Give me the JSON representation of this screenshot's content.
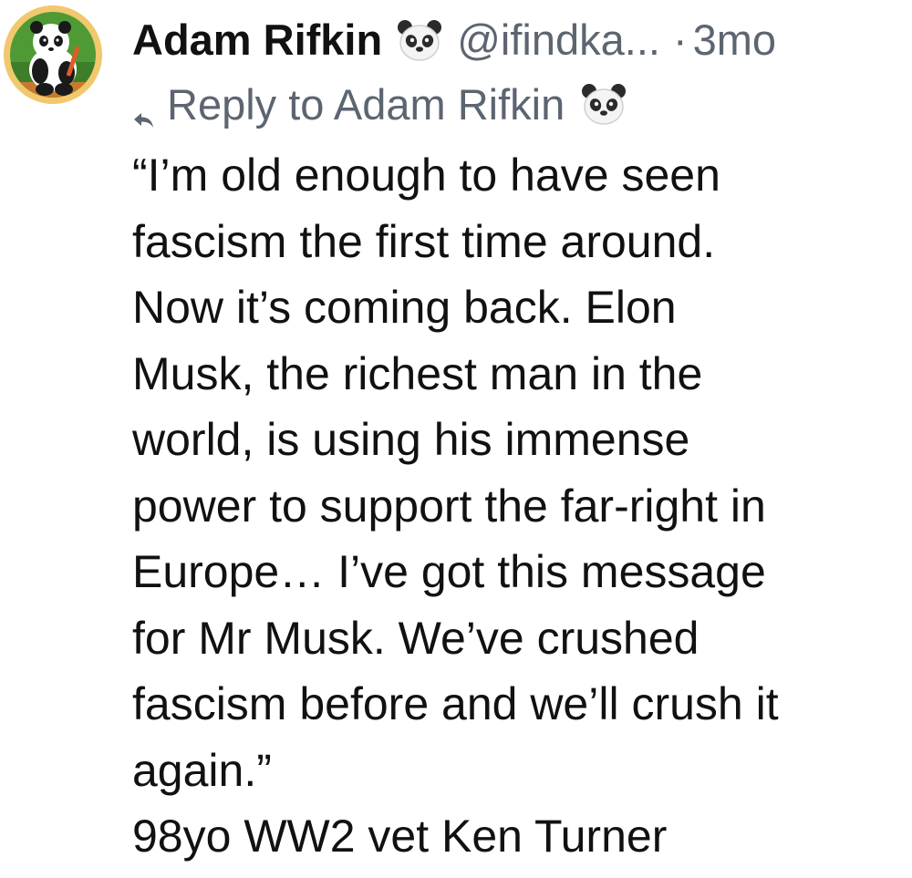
{
  "post": {
    "author": {
      "display_name": "Adam Rifkin",
      "emoji": "panda-face-emoji",
      "handle": "@ifindka...",
      "avatar": "panda-avatar"
    },
    "separator": "·",
    "timestamp": "3mo",
    "reply_to": {
      "icon": "reply-arrow-icon",
      "label": "Reply to Adam Rifkin",
      "emoji": "panda-face-emoji"
    },
    "body_lines": [
      "“I’m old enough to have seen",
      "fascism the first time around.",
      "Now it’s coming back. Elon",
      "Musk, the richest man in the",
      "world, is using his immense",
      "power to support the far-right in",
      "Europe… I’ve got this message",
      "for Mr Musk. We’ve crushed",
      "fascism before and we’ll crush it",
      "again.”",
      "98yo WW2 vet Ken Turner"
    ]
  },
  "colors": {
    "text": "#111111",
    "muted": "#5c6570",
    "avatar_ring": "#f2c86e",
    "avatar_bg": "#4f9a35"
  }
}
